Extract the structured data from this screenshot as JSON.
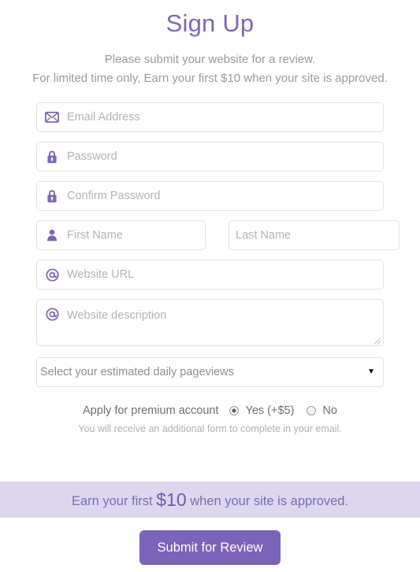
{
  "header": {
    "title": "Sign Up",
    "subtitle_line1": "Please submit your website for a review.",
    "subtitle_line2": "For limited time only, Earn your first $10 when your site is approved."
  },
  "form": {
    "email": {
      "placeholder": "Email Address",
      "icon": "envelope-icon",
      "value": ""
    },
    "password": {
      "placeholder": "Password",
      "icon": "lock-icon",
      "value": ""
    },
    "confirm_password": {
      "placeholder": "Confirm Password",
      "icon": "lock-icon",
      "value": ""
    },
    "first_name": {
      "placeholder": "First Name",
      "icon": "person-icon",
      "value": ""
    },
    "last_name": {
      "placeholder": "Last Name",
      "icon": "",
      "value": ""
    },
    "website_url": {
      "placeholder": "Website URL",
      "icon": "at-icon",
      "value": ""
    },
    "website_description": {
      "placeholder": "Website description",
      "icon": "at-icon",
      "value": ""
    },
    "pageviews_select": {
      "selected_label": "Select your estimated daily pageviews",
      "caret": "▼",
      "value": ""
    }
  },
  "premium": {
    "label": "Apply for premium account",
    "options": [
      {
        "label": "Yes (+$5)",
        "checked": true
      },
      {
        "label": "No",
        "checked": false
      }
    ],
    "note": "You will receive an additional form to complete in your email."
  },
  "promo": {
    "text_before": "Earn your first ",
    "amount": "$10",
    "text_after": " when your site is approved."
  },
  "submit": {
    "label": "Submit for Review"
  },
  "colors": {
    "accent_purple": "#7b68b5",
    "button_purple": "#7a63b8",
    "banner_bg": "#dcd7ef",
    "banner_text": "#7b6eb0",
    "placeholder_gray": "#b3b3b3",
    "border_gray": "#e2e2e2"
  }
}
